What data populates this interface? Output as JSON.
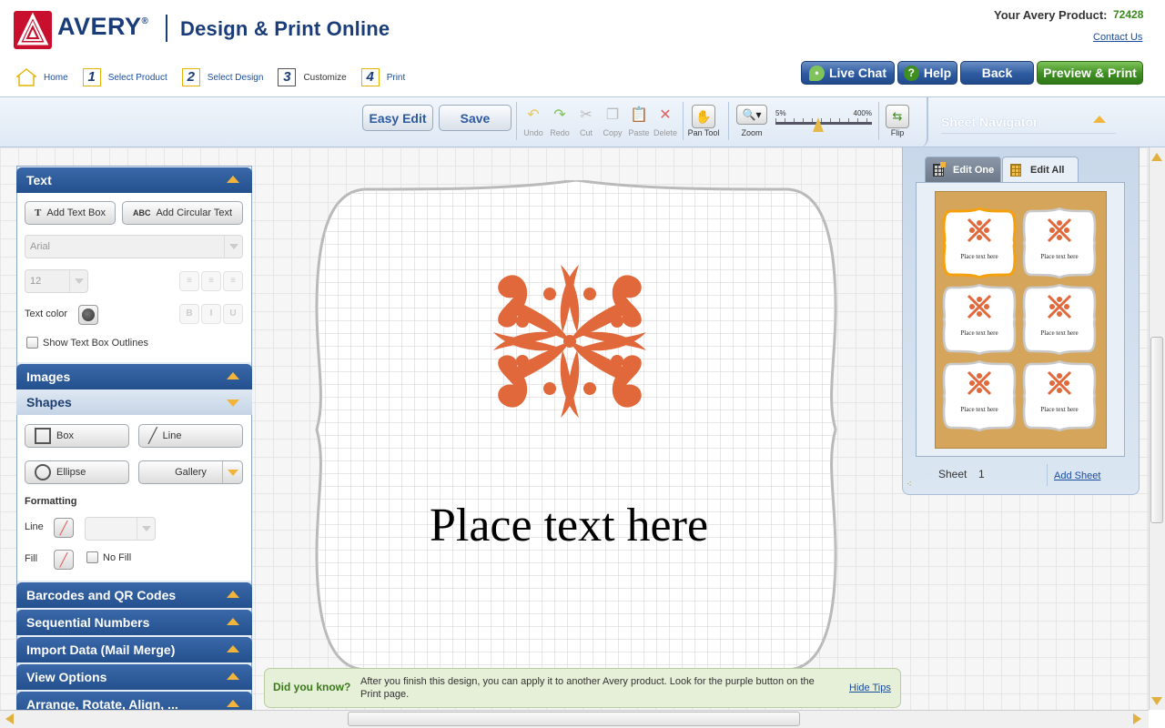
{
  "header": {
    "brand": "AVERY",
    "brand_mark": "®",
    "subtitle": "Design & Print Online",
    "product_label": "Your Avery Product:",
    "product_number": "72428",
    "contact_link": "Contact Us"
  },
  "steps": [
    {
      "num": "",
      "label": "Home"
    },
    {
      "num": "1",
      "label": "Select Product"
    },
    {
      "num": "2",
      "label": "Select Design"
    },
    {
      "num": "3",
      "label": "Customize"
    },
    {
      "num": "4",
      "label": "Print"
    }
  ],
  "top_buttons": {
    "live_chat": "Live Chat",
    "help": "Help",
    "back": "Back",
    "preview_print": "Preview & Print"
  },
  "toolbar": {
    "easy_edit": "Easy Edit",
    "save": "Save",
    "undo": "Undo",
    "redo": "Redo",
    "cut": "Cut",
    "copy": "Copy",
    "paste": "Paste",
    "delete": "Delete",
    "pan_tool": "Pan Tool",
    "zoom": "Zoom",
    "zoom_min": "5%",
    "zoom_max": "400%",
    "zoom_level_fraction": 0.44,
    "flip": "Flip"
  },
  "left_panel": {
    "text_section": {
      "title": "Text",
      "add_text_box": "Add Text Box",
      "add_circular_text": "Add Circular Text",
      "font_value": "Arial",
      "size_value": "12",
      "text_color_label": "Text color",
      "show_outlines_label": "Show Text Box Outlines",
      "align_left": "≡",
      "align_center": "≡",
      "align_right": "≡",
      "bold": "B",
      "italic": "I",
      "underline": "U"
    },
    "images_title": "Images",
    "shapes_section": {
      "title": "Shapes",
      "box": "Box",
      "line": "Line",
      "ellipse": "Ellipse",
      "gallery": "Gallery",
      "formatting_label": "Formatting",
      "line_label": "Line",
      "fill_label": "Fill",
      "no_fill_label": "No Fill"
    },
    "barcodes_title": "Barcodes and QR Codes",
    "sequential_title": "Sequential Numbers",
    "import_title": "Import Data (Mail Merge)",
    "view_title": "View Options",
    "arrange_title": "Arrange, Rotate, Align, ..."
  },
  "canvas": {
    "label_text": "Place text here",
    "motif_color": "#e0683a"
  },
  "tips": {
    "title": "Did you know?",
    "text": "After you finish this design, you can apply it to another Avery product.  Look for the purple button on the Print page.",
    "hide_link": "Hide Tips"
  },
  "sheet_navigator": {
    "title": "Sheet Navigator",
    "tab_edit_one": "Edit One",
    "tab_edit_all": "Edit All",
    "mini_label_text": "Place text here",
    "sheet_label": "Sheet",
    "sheet_number": "1",
    "add_sheet": "Add Sheet"
  },
  "colors": {
    "brand_blue": "#1a3d7a",
    "brand_red": "#c8102e",
    "preview_green": "#3f8e22",
    "sheet_tan": "#d5a55b",
    "highlight_orange": "#f5a00c"
  }
}
